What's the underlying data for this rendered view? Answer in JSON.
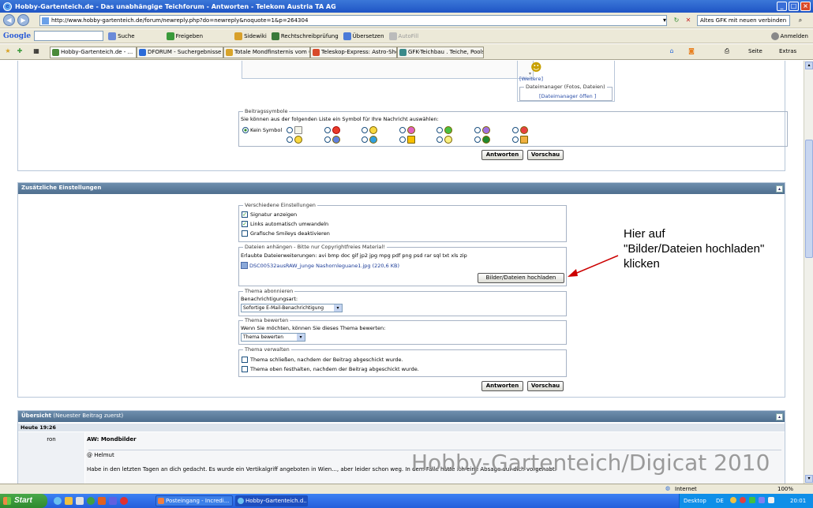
{
  "window": {
    "title": "Hobby-Gartenteich.de - Das unabhängige Teichforum - Antworten - Telekom Austria TA AG",
    "address": "http://www.hobby-gartenteich.de/forum/newreply.php?do=newreply&noquote=1&p=264304",
    "search_value": "Altes GFK mit neuen verbinden"
  },
  "google_toolbar": {
    "logo": "Google",
    "items": [
      "Suche",
      "Freigeben",
      "Sidewiki",
      "Rechtschreibprüfung",
      "Übersetzen",
      "AutoFill"
    ],
    "login": "Anmelden"
  },
  "tabs": [
    {
      "label": "Hobby-Gartenteich.de - ...",
      "active": true,
      "color": "#4a8a3a"
    },
    {
      "label": "DFORUM - Suchergebnisse",
      "active": false,
      "color": "#2a6ad8"
    },
    {
      "label": "Totale Mondfinsternis vom 0...",
      "active": false,
      "color": "#d8a42a"
    },
    {
      "label": "Teleskop-Express: Astro-Sho...",
      "active": false,
      "color": "#d84a2a"
    },
    {
      "label": "GFK-Teichbau . Teiche, Pools...",
      "active": false,
      "color": "#3a8a8a"
    }
  ],
  "commands": {
    "page": "Seite",
    "extras": "Extras"
  },
  "upload_panel": {
    "more_link": "[Weitere]",
    "file_manager_legend": "Dateimanager (Fotos, Dateien)",
    "file_manager_link": "[Dateimanager öffen ]"
  },
  "post_icons": {
    "legend": "Beitragssymbole",
    "description": "Sie können aus der folgenden Liste ein Symbol für Ihre Nachricht auswählen:",
    "no_icon_label": "Kein Symbol"
  },
  "buttons": {
    "reply": "Antworten",
    "preview": "Vorschau",
    "upload": "Bilder/Dateien hochladen"
  },
  "extra_settings": {
    "header": "Zusätzliche Einstellungen",
    "misc_legend": "Verschiedene Einstellungen",
    "misc_options": [
      {
        "label": "Signatur anzeigen",
        "checked": true
      },
      {
        "label": "Links automatisch umwandeln",
        "checked": true
      },
      {
        "label": "Grafische Smileys deaktivieren",
        "checked": false
      }
    ],
    "attach_legend": "Dateien anhängen - Bitte nur Copyrightfreies Material!",
    "allowed_extensions": "Erlaubte Dateierweiterungen: avi bmp doc gif jp2 jpg mpg pdf png psd rar sql txt xls zip",
    "attached_file": "DSC00532ausRAW_junge Nashornleguane1.jpg (220,6 KB)",
    "subscribe_legend": "Thema abonnieren",
    "notify_label": "Benachrichtigungsart:",
    "notify_value": "Sofortige E-Mail-Benachrichtigung",
    "rate_legend": "Thema bewerten",
    "rate_label": "Wenn Sie möchten, können Sie dieses Thema bewerten:",
    "rate_value": "Thema bewerten",
    "manage_legend": "Thema verwalten",
    "manage_options": [
      {
        "label": "Thema schließen, nachdem der Beitrag abgeschickt wurde.",
        "checked": false
      },
      {
        "label": "Thema oben festhalten, nachdem der Beitrag abgeschickt wurde.",
        "checked": false
      }
    ]
  },
  "annotation": {
    "lines": [
      "Hier auf",
      "\"Bilder/Dateien hochladen\"",
      "klicken"
    ],
    "arrow_color": "#cc0000"
  },
  "overview": {
    "header": "Übersicht",
    "header_note": "(Neuester Beitrag zuerst)",
    "date": "Heute 19:26",
    "author": "ron",
    "post_title": "AW: Mondbilder",
    "greeting": "@ Helmut",
    "body": "Habe in den letzten Tagen an dich gedacht. Es wurde ein Vertikalgriff angeboten in Wien..., aber leider schon weg. In dem Falle hatte ich eine Absage auf dich vorgehabt."
  },
  "watermark": "Hobby-Gartenteich/Digicat 2010",
  "status": {
    "zone": "Internet",
    "zoom": "100%"
  },
  "taskbar": {
    "start": "Start",
    "tasks": [
      "Posteingang - Incredi...",
      "Hobby-Gartenteich.d..."
    ],
    "desktop": "Desktop",
    "lang": "DE",
    "clock": "20:01"
  }
}
